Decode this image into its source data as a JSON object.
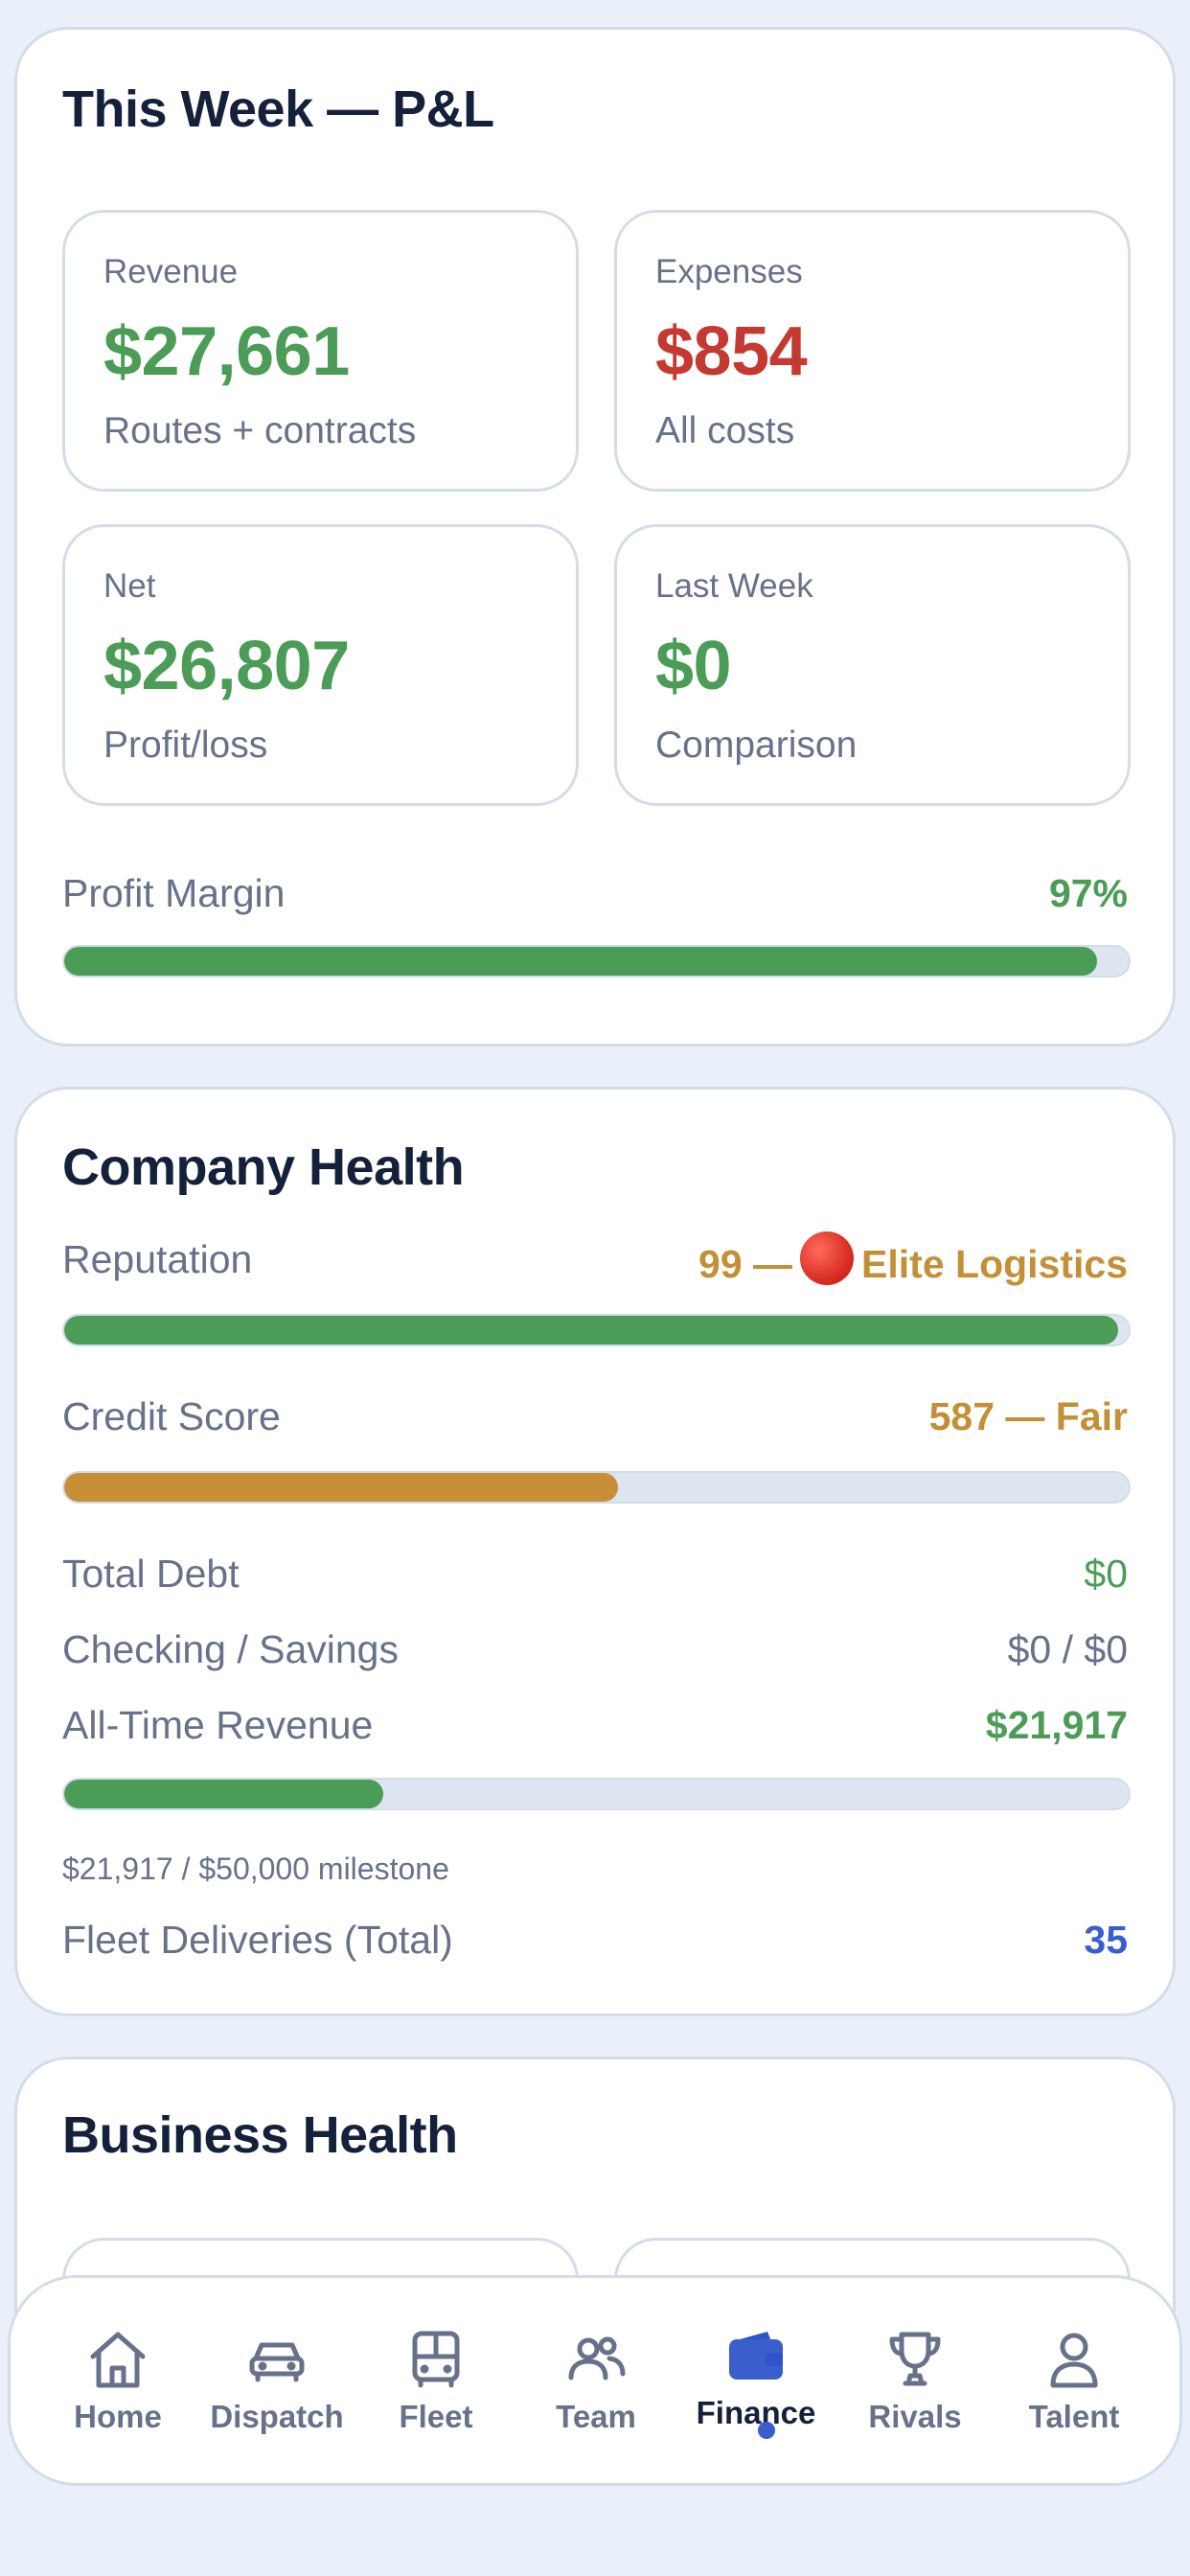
{
  "pl": {
    "title": "This Week — P&L",
    "stats": [
      {
        "label": "Revenue",
        "value": "$27,661",
        "sub": "Routes + contracts",
        "color": "#4a9c56"
      },
      {
        "label": "Expenses",
        "value": "$854",
        "sub": "All costs",
        "color": "#c43a33"
      },
      {
        "label": "Net",
        "value": "$26,807",
        "sub": "Profit/loss",
        "color": "#4a9c56"
      },
      {
        "label": "Last Week",
        "value": "$0",
        "sub": "Comparison",
        "color": "#4a9c56"
      }
    ],
    "margin_label": "Profit Margin",
    "margin_value": "97%",
    "margin_fraction": 0.97
  },
  "health": {
    "title": "Company Health",
    "reputation_label": "Reputation",
    "reputation_score": "99 —",
    "reputation_tier": "Elite Logistics",
    "reputation_fraction": 0.99,
    "credit_label": "Credit Score",
    "credit_value": "587 — Fair",
    "credit_fraction": 0.52,
    "debt_label": "Total Debt",
    "debt_value": "$0",
    "savings_label": "Checking / Savings",
    "savings_value": "$0 / $0",
    "alltime_label": "All-Time Revenue",
    "alltime_value": "$21,917",
    "alltime_fraction": 0.3,
    "milestone_text": "$21,917 / $50,000 milestone",
    "deliveries_label": "Fleet Deliveries (Total)",
    "deliveries_value": "35"
  },
  "business": {
    "title": "Business Health"
  },
  "colors": {
    "green": "#4a9c56",
    "red": "#c43a33",
    "gold": "#c39038",
    "blue": "#3a5fcd",
    "active_tab": "#3a5fcd"
  },
  "nav": {
    "items": [
      {
        "label": "Home",
        "icon": "home-icon"
      },
      {
        "label": "Dispatch",
        "icon": "car-icon"
      },
      {
        "label": "Fleet",
        "icon": "bus-icon"
      },
      {
        "label": "Team",
        "icon": "users-icon"
      },
      {
        "label": "Finance",
        "icon": "wallet-icon",
        "active": true
      },
      {
        "label": "Rivals",
        "icon": "trophy-icon"
      },
      {
        "label": "Talent",
        "icon": "person-icon"
      }
    ]
  }
}
